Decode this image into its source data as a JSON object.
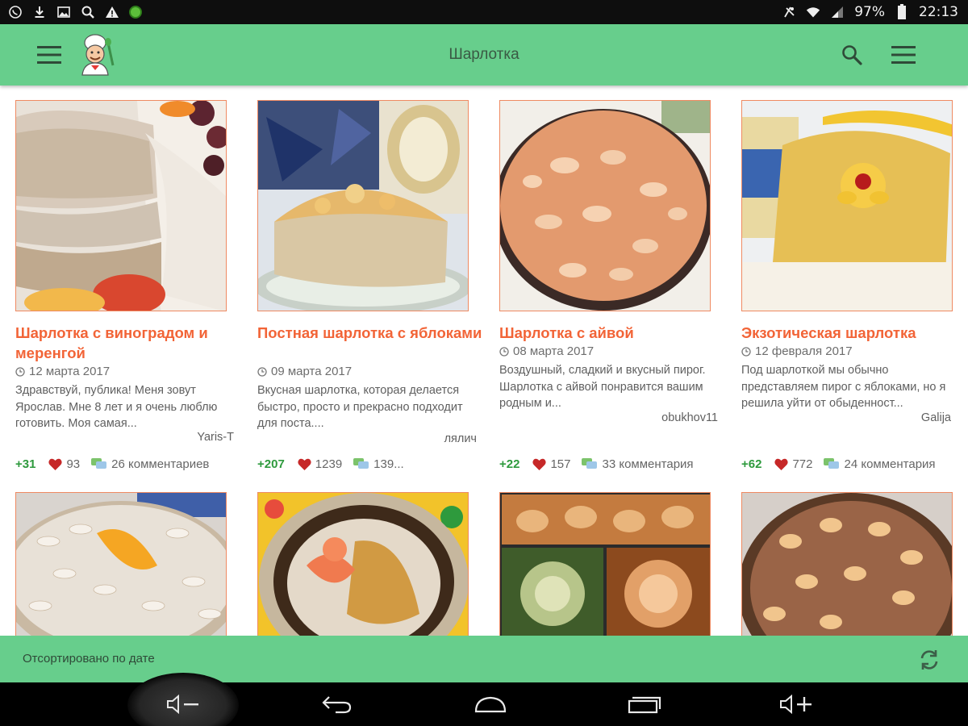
{
  "status_bar": {
    "battery_percent": "97%",
    "time": "22:13",
    "left_icons": [
      "whatsapp-icon",
      "download-icon",
      "image-icon",
      "search-icon",
      "warning-icon",
      "app-icon"
    ],
    "right_icons": [
      "mute-icon",
      "wifi-icon",
      "signal-icon",
      "battery-icon"
    ]
  },
  "toolbar": {
    "title": "Шарлотка",
    "menu_icon": "hamburger-icon",
    "logo_icon": "chef-logo-icon",
    "search_icon": "search-icon",
    "overflow_icon": "menu-lines-icon",
    "background": "#67ce8c"
  },
  "recipes": [
    {
      "title": "Шарлотка с виноградом и меренгой",
      "date": "12 марта 2017",
      "description": "Здравствуй, публика! Меня зовут Ярослав. Мне 8 лет и я очень люблю готовить. Моя самая...",
      "author": "Yaris-T",
      "rating": "+31",
      "likes": "93",
      "comments": "26 комментариев"
    },
    {
      "title": "Постная шарлотка с яблоками",
      "date": "09 марта 2017",
      "description": "Вкусная шарлотка, которая делается быстро, просто и прекрасно подходит для поста....",
      "author": "лялич",
      "rating": "+207",
      "likes": "1239",
      "comments": "139..."
    },
    {
      "title": "Шарлотка с айвой",
      "date": "08 марта 2017",
      "description": "Воздушный, сладкий и вкусный пирог. Шарлотка с айвой понравится вашим родным и...",
      "author": "obukhov11",
      "rating": "+22",
      "likes": "157",
      "comments": "33 комментария"
    },
    {
      "title": "Экзотическая шарлотка",
      "date": "12 февраля 2017",
      "description": "Под шарлоткой мы обычно представляем пирог с яблоками, но я решила уйти от обыденност...",
      "author": "Galija",
      "rating": "+62",
      "likes": "772",
      "comments": "24 комментария"
    },
    {
      "title": "",
      "date": "",
      "description": "",
      "author": "",
      "rating": "",
      "likes": "",
      "comments": ""
    },
    {
      "title": "",
      "date": "",
      "description": "",
      "author": "",
      "rating": "",
      "likes": "",
      "comments": ""
    },
    {
      "title": "",
      "date": "",
      "description": "",
      "author": "",
      "rating": "",
      "likes": "",
      "comments": ""
    },
    {
      "title": "",
      "date": "",
      "description": "",
      "author": "",
      "rating": "",
      "likes": "",
      "comments": ""
    }
  ],
  "sort_bar": {
    "label": "Отсортировано по дате",
    "refresh_icon": "refresh-icon"
  },
  "nav_bar": {
    "buttons": [
      "volume-down-icon",
      "back-icon",
      "home-icon",
      "recents-icon",
      "volume-up-icon"
    ]
  },
  "colors": {
    "accent_green": "#67ce8c",
    "title_orange": "#f26437",
    "rating_green": "#2e9a3d",
    "heart_red": "#c62828"
  }
}
